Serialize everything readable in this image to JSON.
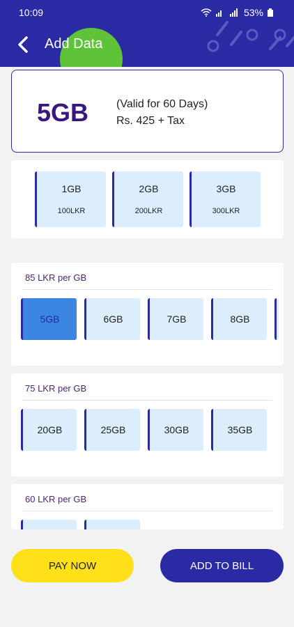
{
  "status": {
    "time": "10:09",
    "battery": "53%"
  },
  "header": {
    "title": "Add Data"
  },
  "selected": {
    "size": "5GB",
    "validity": "(Valid for 60 Days)",
    "price": "Rs. 425 + Tax"
  },
  "quick_packs": [
    {
      "gb": "1GB",
      "price": "100LKR"
    },
    {
      "gb": "2GB",
      "price": "200LKR"
    },
    {
      "gb": "3GB",
      "price": "300LKR"
    }
  ],
  "sections": [
    {
      "label": "85 LKR per GB",
      "options": [
        "5GB",
        "6GB",
        "7GB",
        "8GB"
      ]
    },
    {
      "label": "75 LKR per GB",
      "options": [
        "20GB",
        "25GB",
        "30GB",
        "35GB"
      ]
    },
    {
      "label": "60 LKR per GB",
      "options": []
    }
  ],
  "actions": {
    "pay_now": "PAY NOW",
    "add_to_bill": "ADD TO BILL"
  },
  "colors": {
    "brand": "#2a2aa5",
    "accent_green": "#5fc33a",
    "pay_yellow": "#ffe019",
    "tile_bg": "#dceefc",
    "active_tile": "#3b82e0"
  }
}
